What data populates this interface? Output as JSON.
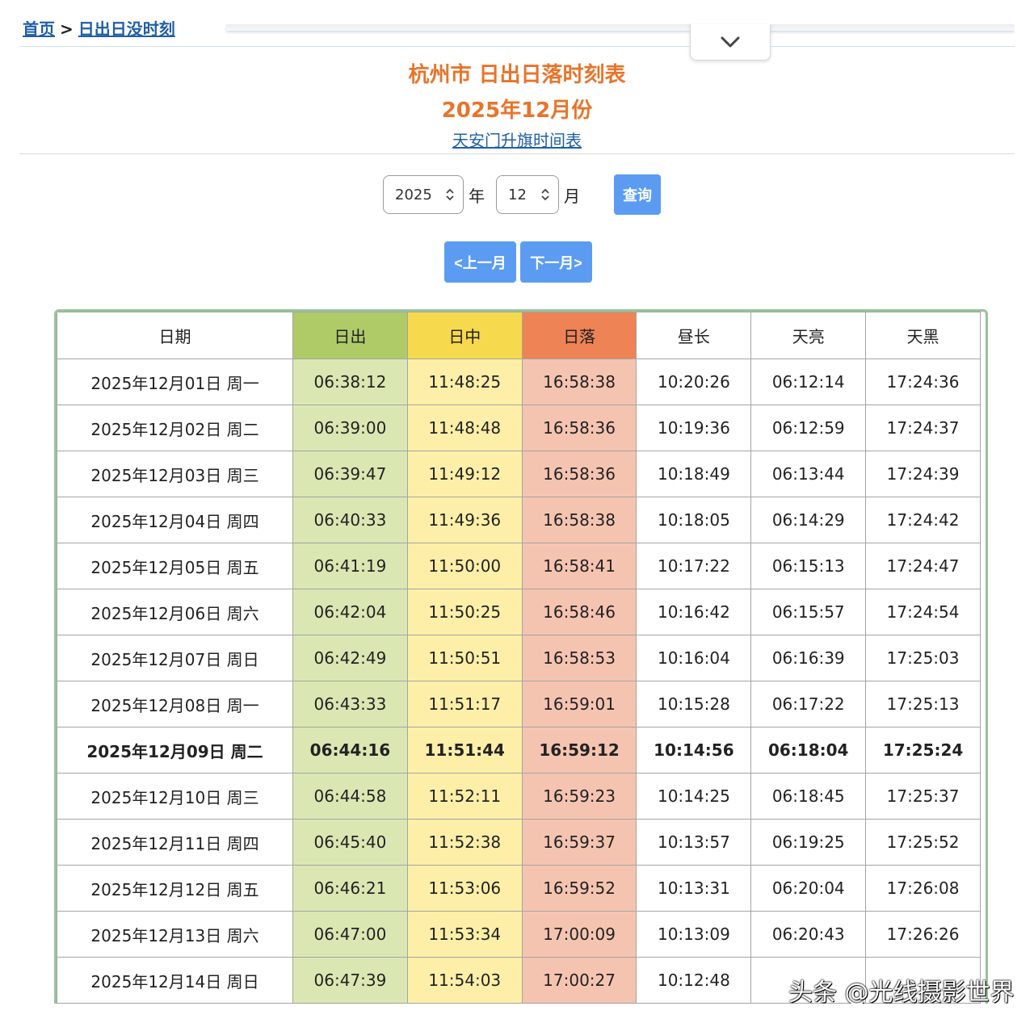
{
  "breadcrumb": {
    "home": "首页",
    "separator": ">",
    "current": "日出日没时刻"
  },
  "header": {
    "title": "杭州市 日出日落时刻表",
    "subtitle": "2025年12月份",
    "flag_link": "天安门升旗时间表"
  },
  "query": {
    "year_value": "2025",
    "year_unit": "年",
    "month_value": "12",
    "month_unit": "月",
    "submit_label": "查询"
  },
  "nav": {
    "prev_label": "<上一月",
    "next_label": "下一月>"
  },
  "colors": {
    "title": "#e8742a",
    "button": "#5b9cf2",
    "link": "#1f5fa8",
    "sunrise": "#aecb68",
    "noon": "#f7d94e",
    "sunset": "#ee8355",
    "border": "#98c39a"
  },
  "table": {
    "columns": [
      "日期",
      "日出",
      "日中",
      "日落",
      "昼长",
      "天亮",
      "天黑"
    ],
    "rows": [
      [
        "2025年12月01日 周一",
        "06:38:12",
        "11:48:25",
        "16:58:38",
        "10:20:26",
        "06:12:14",
        "17:24:36"
      ],
      [
        "2025年12月02日 周二",
        "06:39:00",
        "11:48:48",
        "16:58:36",
        "10:19:36",
        "06:12:59",
        "17:24:37"
      ],
      [
        "2025年12月03日 周三",
        "06:39:47",
        "11:49:12",
        "16:58:36",
        "10:18:49",
        "06:13:44",
        "17:24:39"
      ],
      [
        "2025年12月04日 周四",
        "06:40:33",
        "11:49:36",
        "16:58:38",
        "10:18:05",
        "06:14:29",
        "17:24:42"
      ],
      [
        "2025年12月05日 周五",
        "06:41:19",
        "11:50:00",
        "16:58:41",
        "10:17:22",
        "06:15:13",
        "17:24:47"
      ],
      [
        "2025年12月06日 周六",
        "06:42:04",
        "11:50:25",
        "16:58:46",
        "10:16:42",
        "06:15:57",
        "17:24:54"
      ],
      [
        "2025年12月07日 周日",
        "06:42:49",
        "11:50:51",
        "16:58:53",
        "10:16:04",
        "06:16:39",
        "17:25:03"
      ],
      [
        "2025年12月08日 周一",
        "06:43:33",
        "11:51:17",
        "16:59:01",
        "10:15:28",
        "06:17:22",
        "17:25:13"
      ],
      [
        "2025年12月09日 周二",
        "06:44:16",
        "11:51:44",
        "16:59:12",
        "10:14:56",
        "06:18:04",
        "17:25:24"
      ],
      [
        "2025年12月10日 周三",
        "06:44:58",
        "11:52:11",
        "16:59:23",
        "10:14:25",
        "06:18:45",
        "17:25:37"
      ],
      [
        "2025年12月11日 周四",
        "06:45:40",
        "11:52:38",
        "16:59:37",
        "10:13:57",
        "06:19:25",
        "17:25:52"
      ],
      [
        "2025年12月12日 周五",
        "06:46:21",
        "11:53:06",
        "16:59:52",
        "10:13:31",
        "06:20:04",
        "17:26:08"
      ],
      [
        "2025年12月13日 周六",
        "06:47:00",
        "11:53:34",
        "17:00:09",
        "10:13:09",
        "06:20:43",
        "17:26:26"
      ],
      [
        "2025年12月14日 周日",
        "06:47:39",
        "11:54:03",
        "17:00:27",
        "10:12:48",
        "",
        ""
      ]
    ],
    "highlight_row": 8
  },
  "watermark": "头条 @光线摄影世界"
}
